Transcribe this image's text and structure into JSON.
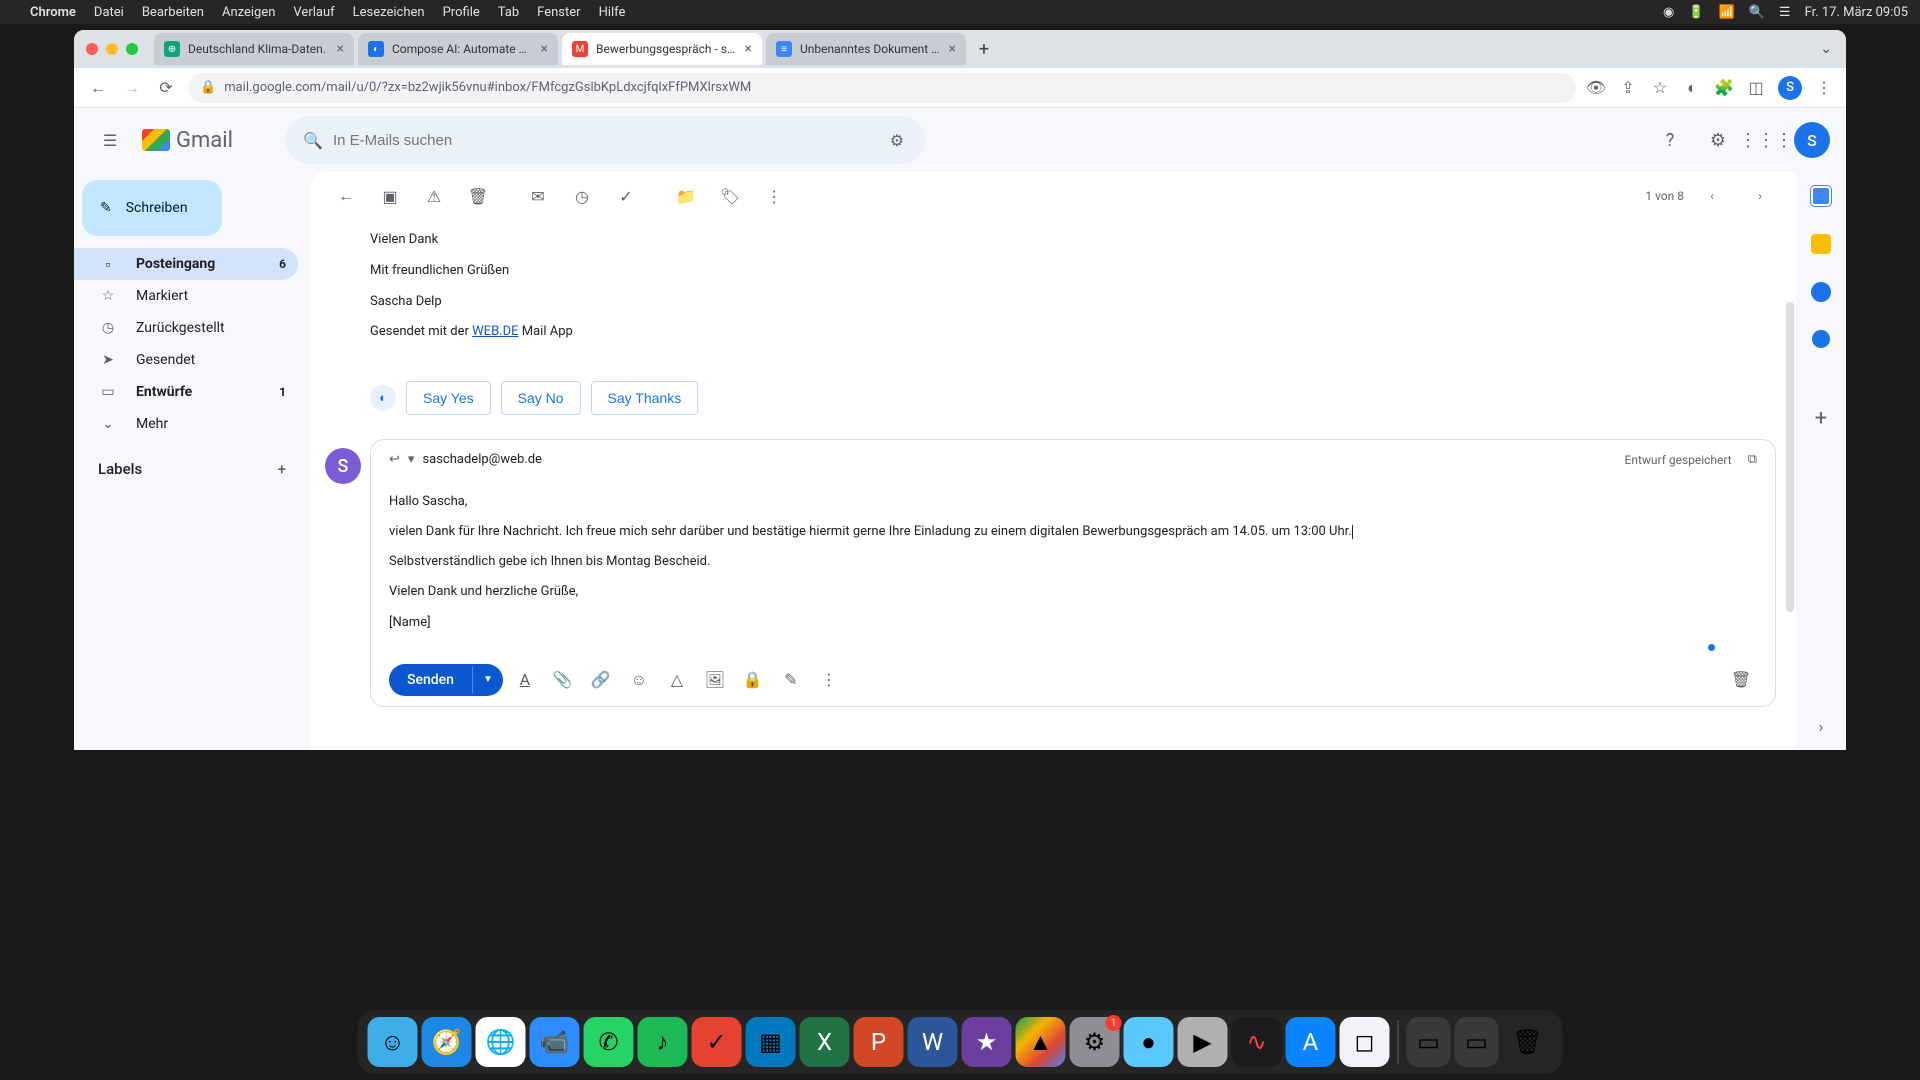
{
  "menubar": {
    "app": "Chrome",
    "items": [
      "Datei",
      "Bearbeiten",
      "Anzeigen",
      "Verlauf",
      "Lesezeichen",
      "Profile",
      "Tab",
      "Fenster",
      "Hilfe"
    ],
    "datetime": "Fr. 17. März  09:05"
  },
  "tabs": [
    {
      "title": "Deutschland Klima-Daten.",
      "icon_bg": "#10a37f",
      "icon_text": "⊕"
    },
    {
      "title": "Compose AI: Automate Your W",
      "icon_bg": "#1a73e8",
      "icon_text": "◐"
    },
    {
      "title": "Bewerbungsgespräch - sascha",
      "icon_bg": "#ea4335",
      "icon_text": "M",
      "active": true
    },
    {
      "title": "Unbenanntes Dokument - Goo",
      "icon_bg": "#4285f4",
      "icon_text": "≡"
    }
  ],
  "url": "mail.google.com/mail/u/0/?zx=bz2wjik56vnu#inbox/FMfcgzGslbKpLdxcjfqlxFfPMXlrsxWM",
  "gmail": {
    "brand": "Gmail",
    "search_placeholder": "In E-Mails suchen",
    "compose": "Schreiben",
    "nav": [
      {
        "icon": "▫",
        "label": "Posteingang",
        "count": "6",
        "active": true,
        "bold": true
      },
      {
        "icon": "☆",
        "label": "Markiert"
      },
      {
        "icon": "◷",
        "label": "Zurückgestellt"
      },
      {
        "icon": "➤",
        "label": "Gesendet"
      },
      {
        "icon": "▭",
        "label": "Entwürfe",
        "count": "1",
        "bold": true
      },
      {
        "icon": "⌄",
        "label": "Mehr"
      }
    ],
    "labels_header": "Labels",
    "pager": "1 von 8",
    "original": {
      "thanks": "Vielen Dank",
      "greeting": "Mit freundlichen Grüßen",
      "signature": "Sascha Delp",
      "sent_via_prefix": "Gesendet mit der ",
      "sent_via_link": "WEB.DE",
      "sent_via_suffix": " Mail App"
    },
    "suggestions": [
      "Say Yes",
      "Say No",
      "Say Thanks"
    ],
    "reply": {
      "recipient": "saschadelp@web.de",
      "saved": "Entwurf gespeichert",
      "lines": {
        "l1": "Hallo Sascha,",
        "l2": "vielen Dank für Ihre Nachricht. Ich freue mich sehr darüber und bestätige hiermit gerne Ihre Einladung zu einem digitalen Bewerbungsgespräch am 14.05. um 13:00 Uhr.",
        "l3": "Selbstverständlich gebe ich Ihnen bis Montag Bescheid.",
        "l4": "Vielen Dank und herzliche Grüße,",
        "l5": "[Name]"
      },
      "send": "Senden"
    },
    "avatar_letter": "S"
  },
  "dock": {
    "items": [
      {
        "bg": "#3eaee8",
        "glyph": "☺"
      },
      {
        "bg": "#1e88e5",
        "glyph": "🧭"
      },
      {
        "bg": "#fff",
        "glyph": "🌐"
      },
      {
        "bg": "#2d8cff",
        "glyph": "📹"
      },
      {
        "bg": "#25d366",
        "glyph": "✆"
      },
      {
        "bg": "#1db954",
        "glyph": "♪"
      },
      {
        "bg": "#e44332",
        "glyph": "✓"
      },
      {
        "bg": "#0079bf",
        "glyph": "▦"
      },
      {
        "bg": "#217346",
        "glyph": "X"
      },
      {
        "bg": "#d24726",
        "glyph": "P"
      },
      {
        "bg": "#2b579a",
        "glyph": "W"
      },
      {
        "bg": "#6b3fa0",
        "glyph": "★"
      },
      {
        "bg": "linear-gradient(135deg,#0f9d58,#f4b400,#db4437,#4285f4)",
        "glyph": "▲"
      },
      {
        "bg": "#8e8e93",
        "glyph": "⚙",
        "badge": "1"
      },
      {
        "bg": "#5ac8fa",
        "glyph": "●"
      },
      {
        "bg": "#b0b0b0",
        "glyph": "▶"
      },
      {
        "bg": "#1c1c1e",
        "glyph": "∿"
      },
      {
        "bg": "#0a84ff",
        "glyph": "A"
      },
      {
        "bg": "#f2f2f7",
        "glyph": "◻"
      }
    ],
    "right": [
      {
        "bg": "#3a3a3c",
        "glyph": "▭"
      },
      {
        "bg": "#3a3a3c",
        "glyph": "▭"
      },
      {
        "bg": "#d0d0d0",
        "glyph": "🗑"
      }
    ]
  }
}
